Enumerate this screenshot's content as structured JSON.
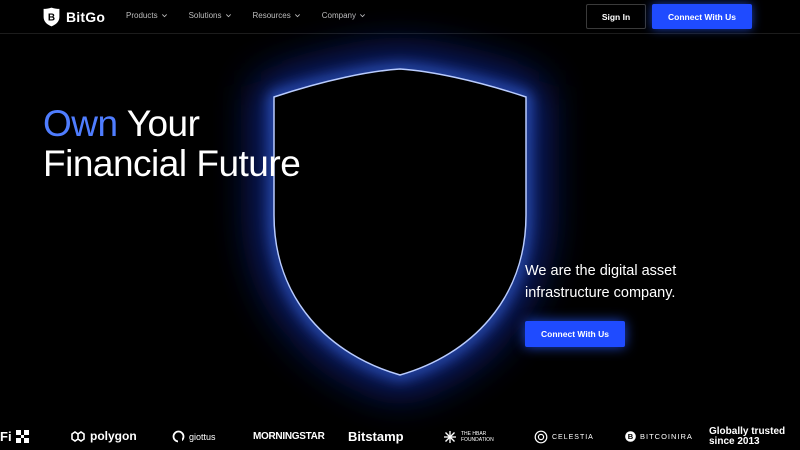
{
  "brand": {
    "name": "BitGo",
    "accent": "#1f4bff",
    "accent_text": "#4f7dff"
  },
  "nav": {
    "items": [
      {
        "label": "Products"
      },
      {
        "label": "Solutions"
      },
      {
        "label": "Resources"
      },
      {
        "label": "Company"
      }
    ],
    "sign_in": "Sign In",
    "cta": "Connect With Us"
  },
  "hero": {
    "headline_accent": "Own",
    "headline_rest": " Your",
    "headline_line2": "Financial Future",
    "tagline_line1": "We are the digital asset",
    "tagline_line2": "infrastructure company.",
    "cta": "Connect With Us"
  },
  "partners": {
    "items": [
      {
        "label": "Fi",
        "icon": "grid-icon"
      },
      {
        "label": "polygon",
        "icon": "polygon-icon"
      },
      {
        "label": "giottus",
        "icon": "giottus-icon"
      },
      {
        "label": "MORNINGSTAR",
        "icon": ""
      },
      {
        "label": "Bitstamp",
        "icon": ""
      },
      {
        "label": "THE HBAR FOUNDATION",
        "icon": "hbar-icon"
      },
      {
        "label": "CELESTIA",
        "icon": "celestia-icon"
      },
      {
        "label": "BITCOINIRA",
        "icon": "bitcoin-icon"
      }
    ],
    "trusted_line1": "Globally trusted",
    "trusted_line2": "since 2013"
  }
}
